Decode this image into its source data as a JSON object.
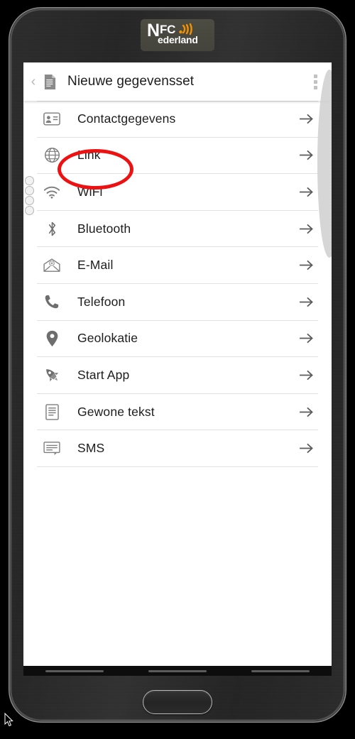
{
  "device": {
    "brand_logo": {
      "n": "N",
      "fc": "FC",
      "ederland": "ederland",
      "wave_color": "#f39200",
      "text_color": "#ffffff",
      "plate_color": "#4a4940"
    },
    "home_button_label": "home-button",
    "nav_keys": [
      "recents",
      "home",
      "back"
    ]
  },
  "header": {
    "back_glyph": "‹",
    "doc_icon": "document-icon",
    "title": "Nieuwe gegevensset",
    "overflow_icon": "overflow-menu-icon"
  },
  "list": {
    "arrow_glyph": "→",
    "items": [
      {
        "label": "Contactgegevens",
        "icon": "contact-card-icon"
      },
      {
        "label": "Link",
        "icon": "globe-icon"
      },
      {
        "label": "WiFi",
        "icon": "wifi-icon"
      },
      {
        "label": "Bluetooth",
        "icon": "bluetooth-icon"
      },
      {
        "label": "E-Mail",
        "icon": "envelope-icon"
      },
      {
        "label": "Telefoon",
        "icon": "phone-icon"
      },
      {
        "label": "Geolokatie",
        "icon": "map-pin-icon"
      },
      {
        "label": "Start App",
        "icon": "rocket-icon"
      },
      {
        "label": "Gewone tekst",
        "icon": "text-document-icon"
      },
      {
        "label": "SMS",
        "icon": "speech-bubble-icon"
      }
    ]
  },
  "annotation": {
    "type": "ellipse-highlight",
    "target": "Link",
    "color": "#ee1111"
  },
  "colors": {
    "accent_orange": "#f39200",
    "annotation_red": "#ee1111",
    "icon_grey": "#7d7d7d",
    "divider": "#e2e2e2",
    "text": "#1c1c1c"
  }
}
